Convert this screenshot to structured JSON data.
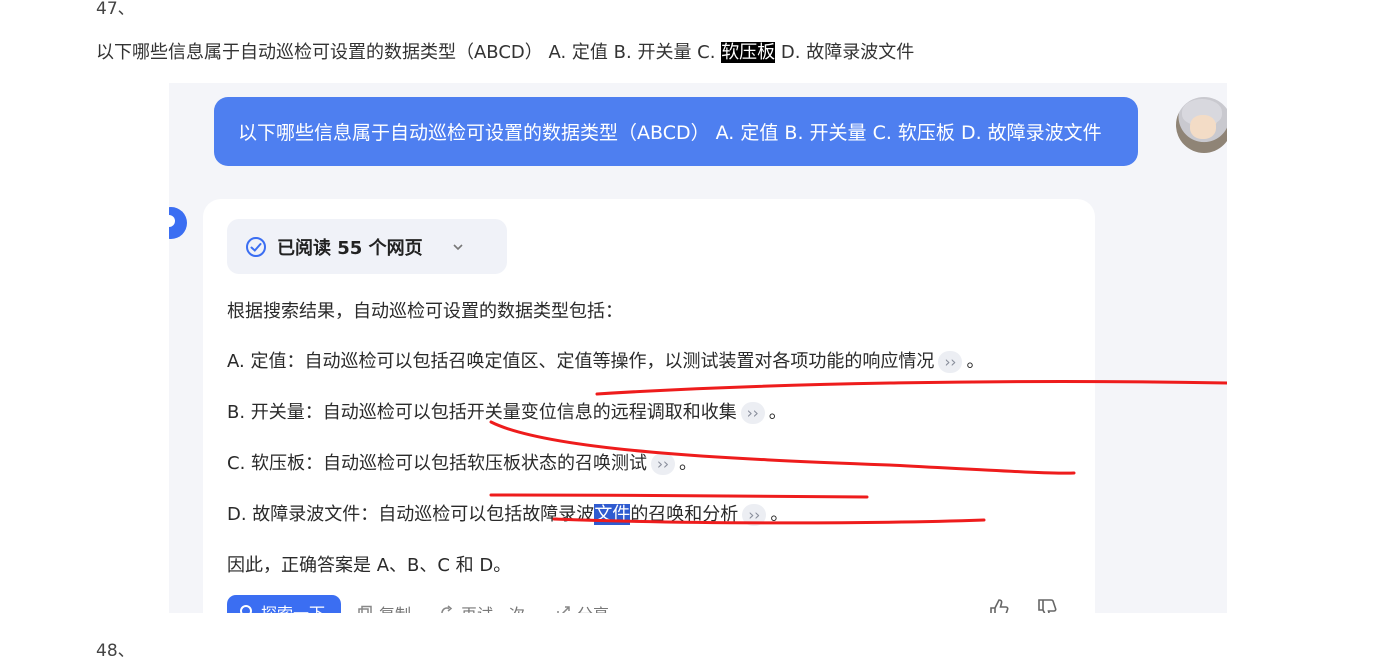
{
  "question_numbers": {
    "top": "47、",
    "bottom": "48、"
  },
  "question": {
    "before_highlight": "以下哪些信息属于自动巡检可设置的数据类型（ABCD） A. 定值 B. 开关量 C. ",
    "highlight": "软压板",
    "after_highlight": " D. 故障录波文件"
  },
  "chat": {
    "user_message": "以下哪些信息属于自动巡检可设置的数据类型（ABCD） A. 定值 B. 开关量 C. 软压板 D. 故障录波文件",
    "read_pill": {
      "label": "已阅读 55 个网页",
      "icon": "check-circle-icon",
      "chevron": "chevron-down-icon"
    },
    "answer": {
      "intro": "根据搜索结果，自动巡检可设置的数据类型包括：",
      "item_a": "A. 定值：自动巡检可以包括召唤定值区、定值等操作，以测试装置对各项功能的响应情况",
      "item_b": "B. 开关量：自动巡检可以包括开关量变位信息的远程调取和收集",
      "item_c": "C. 软压板：自动巡检可以包括软压板状态的召唤测试",
      "item_d_before": "D. 故障录波文件：自动巡检可以包括故障录波",
      "item_d_selected": "文件",
      "item_d_after": "的召唤和分析",
      "cite_mark": "››",
      "period": "。",
      "conclusion": "因此，正确答案是 A、B、C 和 D。"
    },
    "actions": {
      "explore": "探索一下",
      "copy": "复制",
      "retry": "再试一次",
      "share": "分享"
    },
    "colors": {
      "accent": "#4e7ff0",
      "annotation": "#ee1c1c",
      "selection": "#2f5bd0"
    }
  }
}
